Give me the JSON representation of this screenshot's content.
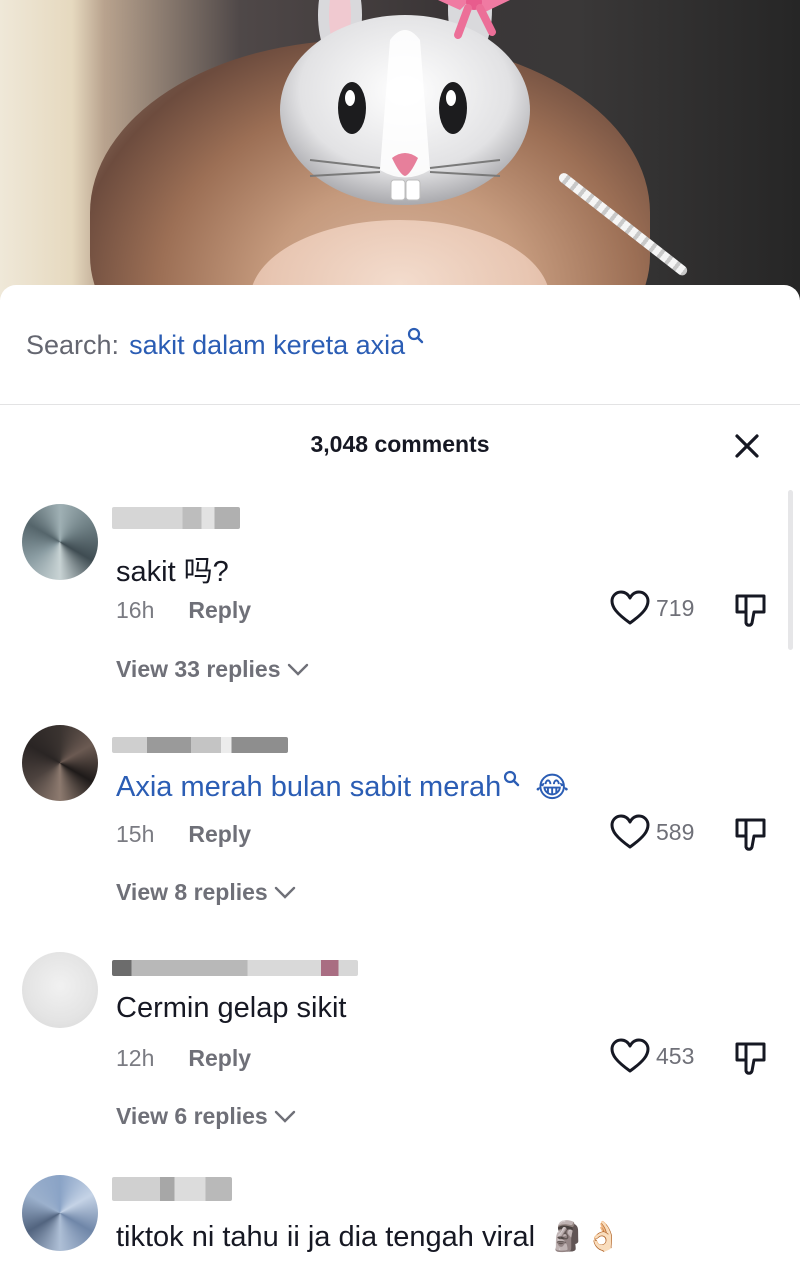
{
  "video": {
    "filter_icon": "bunny-face-filter"
  },
  "search": {
    "prefix": "Search:",
    "term": "sakit dalam kereta axia",
    "icon": "search-icon"
  },
  "header": {
    "comments_count": "3,048 comments",
    "close_icon": "close-icon"
  },
  "comments": [
    {
      "text": "sakit 吗?",
      "time": "16h",
      "reply_label": "Reply",
      "likes": "719",
      "view_replies": "View 33 replies",
      "is_search_link": false
    },
    {
      "text": "Axia merah bulan sabit merah",
      "emoji": "😂",
      "time": "15h",
      "reply_label": "Reply",
      "likes": "589",
      "view_replies": "View 8 replies",
      "is_search_link": true
    },
    {
      "text": "Cermin gelap sikit",
      "time": "12h",
      "reply_label": "Reply",
      "likes": "453",
      "view_replies": "View 6 replies",
      "is_search_link": false
    },
    {
      "text": "tiktok ni tahu ii ja dia tengah viral",
      "emoji": "🗿👌🏻",
      "is_search_link": false
    }
  ],
  "colors": {
    "link_blue": "#2b5db4",
    "text_primary": "#161823",
    "text_secondary": "#6f7078"
  }
}
